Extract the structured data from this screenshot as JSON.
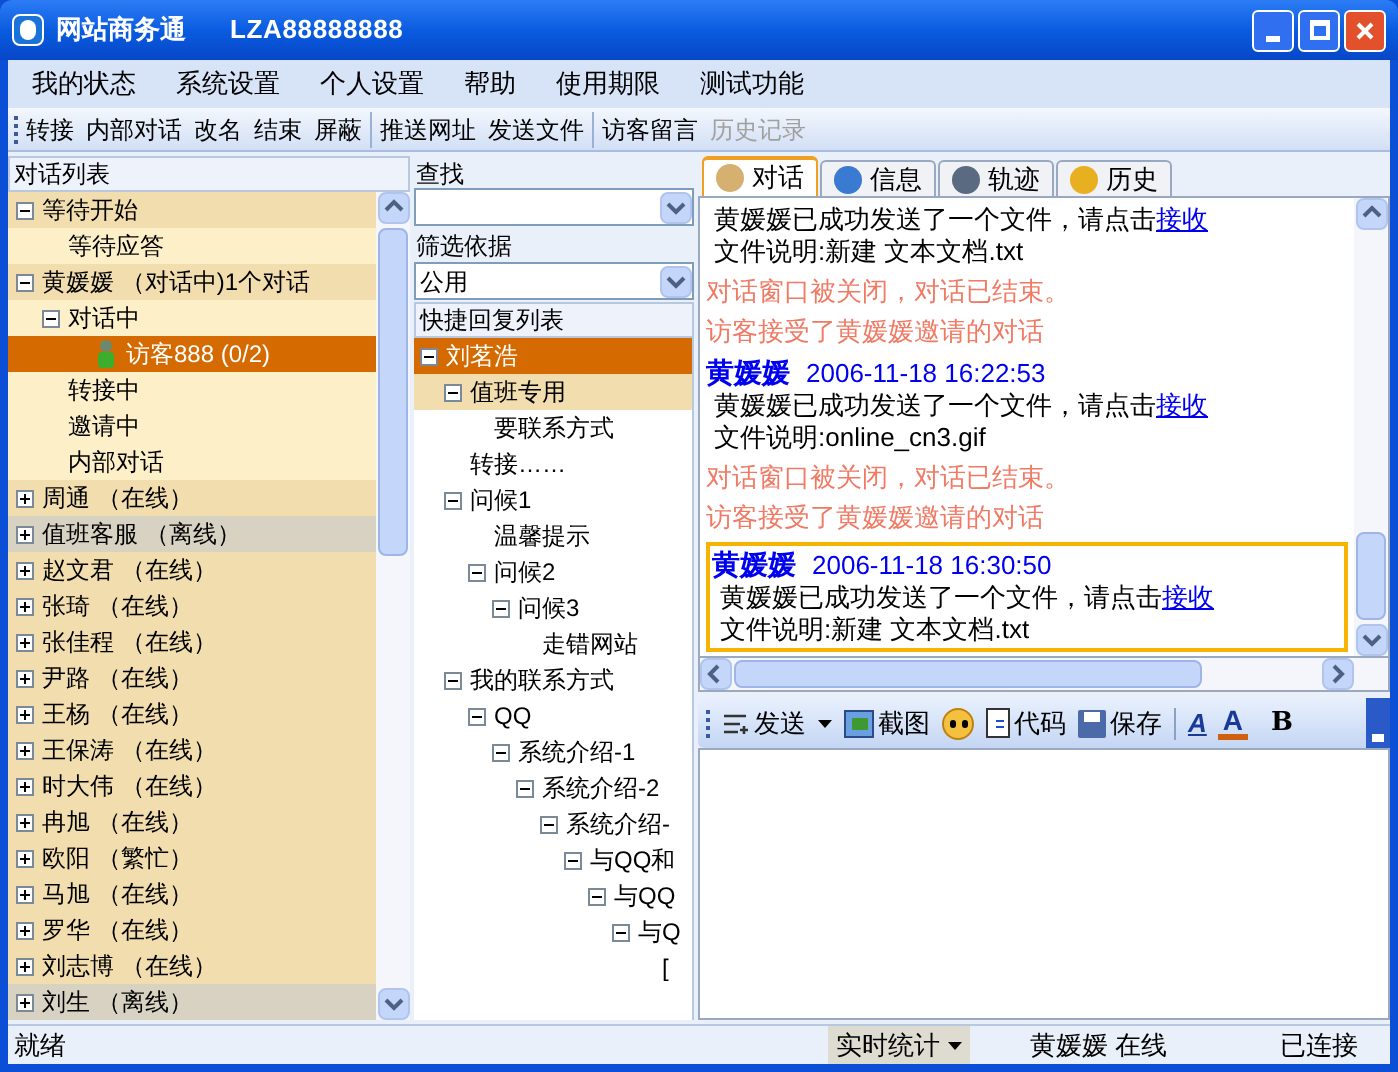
{
  "window": {
    "title": "网站商务通",
    "account": "LZA88888888"
  },
  "menu": [
    "我的状态",
    "系统设置",
    "个人设置",
    "帮助",
    "使用期限",
    "测试功能"
  ],
  "toolbar": [
    [
      {
        "label": "转接",
        "disabled": false
      },
      {
        "label": "内部对话",
        "disabled": false
      },
      {
        "label": "改名",
        "disabled": false
      },
      {
        "label": "结束",
        "disabled": false
      },
      {
        "label": "屏蔽",
        "disabled": false
      }
    ],
    [
      {
        "label": "推送网址",
        "disabled": false
      },
      {
        "label": "发送文件",
        "disabled": false
      }
    ],
    [
      {
        "label": "访客留言",
        "disabled": false
      },
      {
        "label": "历史记录",
        "disabled": true
      }
    ]
  ],
  "conversation_list": {
    "title": "对话列表",
    "items": [
      {
        "label": "等待开始",
        "expanded": true,
        "offline": false,
        "children": [
          {
            "label": "等待应答"
          }
        ]
      },
      {
        "label": "黄媛媛 （对话中)1个对话",
        "expanded": true,
        "offline": false,
        "children": [
          {
            "label": "对话中",
            "expanded": true,
            "children": [
              {
                "label": "访客888 (0/2)",
                "kind": "visitor",
                "selected": true
              }
            ]
          },
          {
            "label": "转接中"
          },
          {
            "label": "邀请中"
          },
          {
            "label": "内部对话"
          }
        ]
      },
      {
        "label": "周通 （在线）",
        "expanded": false,
        "offline": false
      },
      {
        "label": "值班客服 （离线）",
        "expanded": false,
        "offline": true
      },
      {
        "label": "赵文君 （在线）",
        "expanded": false,
        "offline": false
      },
      {
        "label": "张琦 （在线）",
        "expanded": false,
        "offline": false
      },
      {
        "label": "张佳程 （在线）",
        "expanded": false,
        "offline": false
      },
      {
        "label": "尹路 （在线）",
        "expanded": false,
        "offline": false
      },
      {
        "label": "王杨 （在线）",
        "expanded": false,
        "offline": false
      },
      {
        "label": "王保涛 （在线）",
        "expanded": false,
        "offline": false
      },
      {
        "label": "时大伟 （在线）",
        "expanded": false,
        "offline": false
      },
      {
        "label": "冉旭 （在线）",
        "expanded": false,
        "offline": false
      },
      {
        "label": "欧阳 （繁忙）",
        "expanded": false,
        "offline": false
      },
      {
        "label": "马旭 （在线）",
        "expanded": false,
        "offline": false
      },
      {
        "label": "罗华 （在线）",
        "expanded": false,
        "offline": false
      },
      {
        "label": "刘志博 （在线）",
        "expanded": false,
        "offline": false
      },
      {
        "label": "刘生 （离线）",
        "expanded": false,
        "offline": true
      }
    ]
  },
  "search": {
    "label": "查找"
  },
  "filter": {
    "label": "筛选依据",
    "value": "公用"
  },
  "quick_replies": {
    "title": "快捷回复列表",
    "items": [
      {
        "label": "刘茗浩",
        "selected": true,
        "highlighted": false,
        "children": [
          {
            "label": "值班专用",
            "selected": false,
            "highlighted": true,
            "children": [
              {
                "label": "要联系方式"
              }
            ]
          },
          {
            "label": "转接……"
          },
          {
            "label": "问候1",
            "selected": false,
            "highlighted": false,
            "children": [
              {
                "label": "温馨提示"
              },
              {
                "label": "问候2",
                "selected": false,
                "highlighted": false,
                "children": [
                  {
                    "label": "问候3",
                    "selected": false,
                    "highlighted": false,
                    "children": [
                      {
                        "label": "走错网站"
                      }
                    ]
                  }
                ]
              }
            ]
          },
          {
            "label": "我的联系方式",
            "selected": false,
            "highlighted": false,
            "children": [
              {
                "label": "QQ",
                "selected": false,
                "highlighted": false,
                "children": [
                  {
                    "label": "系统介绍-1",
                    "selected": false,
                    "highlighted": false,
                    "children": [
                      {
                        "label": "系统介绍-2",
                        "selected": false,
                        "highlighted": false,
                        "children": [
                          {
                            "label": "系统介绍-",
                            "selected": false,
                            "highlighted": false,
                            "children": [
                              {
                                "label": "与QQ和",
                                "selected": false,
                                "highlighted": false,
                                "children": [
                                  {
                                    "label": "与QQ",
                                    "selected": false,
                                    "highlighted": false,
                                    "children": [
                                      {
                                        "label": "与Q",
                                        "selected": false,
                                        "highlighted": false,
                                        "children": [
                                          {
                                            "label": "[",
                                            "selected": false,
                                            "highlighted": false
                                          }
                                        ]
                                      }
                                    ]
                                  }
                                ]
                              }
                            ]
                          }
                        ]
                      }
                    ]
                  }
                ]
              }
            ]
          }
        ]
      }
    ]
  },
  "tabs": [
    {
      "label": "对话",
      "selected": true
    },
    {
      "label": "信息",
      "selected": false
    },
    {
      "label": "轨迹",
      "selected": false
    },
    {
      "label": "历史",
      "selected": false
    }
  ],
  "messages": [
    {
      "kind": "file",
      "highlighted": false,
      "text": "黄媛媛已成功发送了一个文件，请点击",
      "link": "接收",
      "note": "文件说明:新建 文本文档.txt"
    },
    {
      "kind": "system",
      "text": "对话窗口被关闭，对话已结束。"
    },
    {
      "kind": "system",
      "text": "访客接受了黄媛媛邀请的对话"
    },
    {
      "kind": "file",
      "highlighted": false,
      "sender": "黄媛媛",
      "time": "2006-11-18 16:22:53",
      "text": "黄媛媛已成功发送了一个文件，请点击",
      "link": "接收",
      "note": "文件说明:online_cn3.gif"
    },
    {
      "kind": "system",
      "text": "对话窗口被关闭，对话已结束。"
    },
    {
      "kind": "system",
      "text": "访客接受了黄媛媛邀请的对话"
    },
    {
      "kind": "file",
      "highlighted": true,
      "sender": "黄媛媛",
      "time": "2006-11-18 16:30:50",
      "text": "黄媛媛已成功发送了一个文件，请点击",
      "link": "接收",
      "note": "文件说明:新建 文本文档.txt"
    }
  ],
  "format_toolbar": {
    "send": "发送",
    "screenshot": "截图",
    "code": "代码",
    "save": "保存",
    "font_size": "A",
    "font_color": "A",
    "bold": "B"
  },
  "status_bar": {
    "status": "就绪",
    "stats": "实时统计",
    "user": "黄媛媛 在线",
    "connection": "已连接"
  }
}
